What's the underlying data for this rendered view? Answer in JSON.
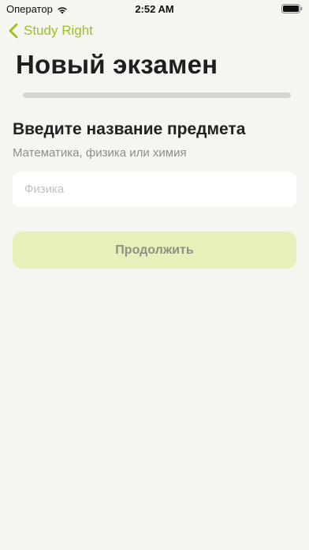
{
  "status_bar": {
    "carrier": "Оператор",
    "time": "2:52 AM",
    "wifi_icon": "wifi-icon",
    "battery_icon": "battery-icon"
  },
  "nav": {
    "back_label": "Study Right",
    "back_icon": "chevron-left-icon",
    "accent_color": "#9cc21a"
  },
  "page": {
    "title": "Новый экзамен",
    "progress": 0
  },
  "form": {
    "question": "Введите название предмета",
    "hint": "Математика, физика или химия",
    "subject_input": {
      "value": "",
      "placeholder": "Физика"
    }
  },
  "actions": {
    "continue_label": "Продолжить"
  }
}
